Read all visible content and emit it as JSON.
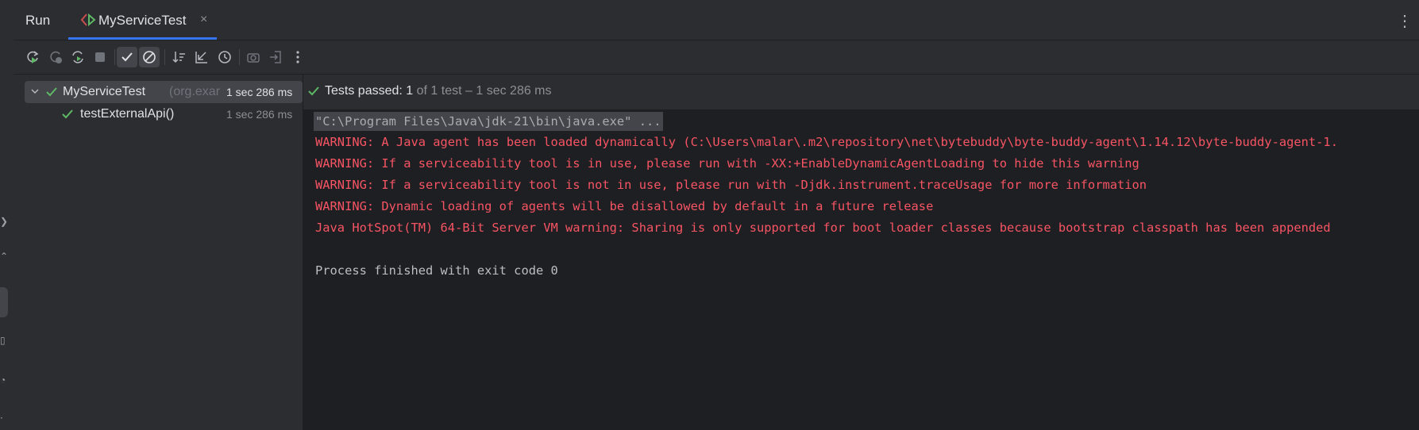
{
  "panel": {
    "title": "Run"
  },
  "tab": {
    "label": "MyServiceTest",
    "close": "×"
  },
  "toolbar": {
    "buttons": [
      "rerun-icon",
      "rerun-failed-icon",
      "toggle-auto-test-icon",
      "stop-icon",
      "show-passed-icon",
      "show-ignored-icon",
      "sort-icon",
      "collapse-icon",
      "test-history-icon",
      "export-icon",
      "import-icon",
      "more-icon"
    ]
  },
  "tree": {
    "root": {
      "name": "MyServiceTest",
      "package": "(org.exar",
      "time": "1 sec 286 ms"
    },
    "children": [
      {
        "name": "testExternalApi()",
        "time": "1 sec 286 ms"
      }
    ]
  },
  "status": {
    "label": "Tests passed:",
    "count": "1",
    "detail": "of 1 test – 1 sec 286 ms"
  },
  "console": {
    "lines": [
      {
        "type": "cmd",
        "text": "\"C:\\Program Files\\Java\\jdk-21\\bin\\java.exe\" ..."
      },
      {
        "type": "warn",
        "text": "WARNING: A Java agent has been loaded dynamically (C:\\Users\\malar\\.m2\\repository\\net\\bytebuddy\\byte-buddy-agent\\1.14.12\\byte-buddy-agent-1."
      },
      {
        "type": "warn",
        "text": "WARNING: If a serviceability tool is in use, please run with -XX:+EnableDynamicAgentLoading to hide this warning"
      },
      {
        "type": "warn",
        "text": "WARNING: If a serviceability tool is not in use, please run with -Djdk.instrument.traceUsage for more information"
      },
      {
        "type": "warn",
        "text": "WARNING: Dynamic loading of agents will be disallowed by default in a future release"
      },
      {
        "type": "warn",
        "text": "Java HotSpot(TM) 64-Bit Server VM warning: Sharing is only supported for boot loader classes because bootstrap classpath has been appended"
      },
      {
        "type": "blank",
        "text": ""
      },
      {
        "type": "plain",
        "text": "Process finished with exit code 0"
      }
    ]
  },
  "colors": {
    "pass": "#5fb865",
    "warning": "#f75464",
    "accent": "#3574f0"
  }
}
